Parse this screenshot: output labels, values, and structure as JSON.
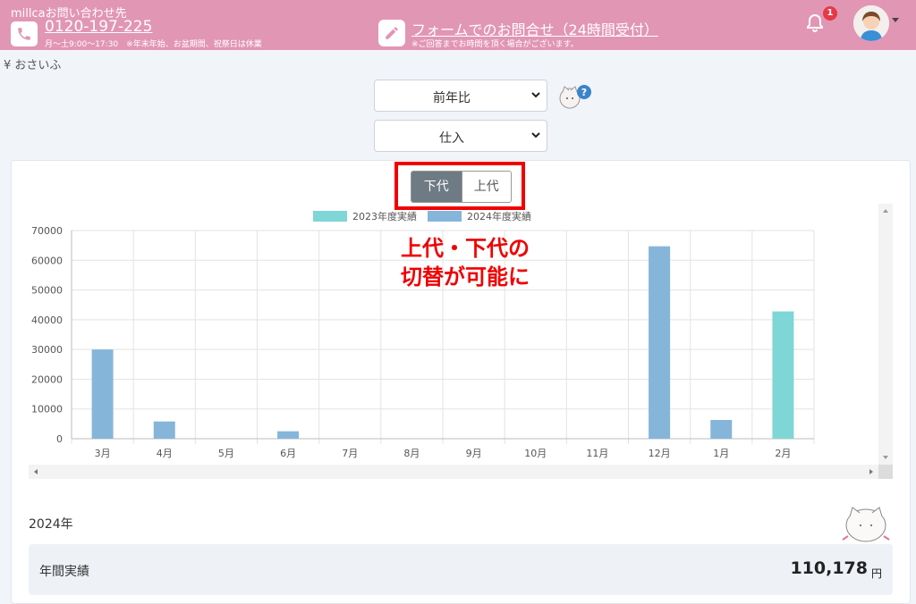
{
  "header": {
    "brand": "millcaお問い合わせ先",
    "phone": "0120-197-225",
    "hours": "月～土9:00～17:30　※年末年始、お盆期間、祝祭日は休業",
    "form_link": "フォームでのお問合せ（24時間受付）",
    "form_note": "※ご回答までお時間を頂く場合がございます。",
    "notification_count": "1"
  },
  "breadcrumb": "¥ おさいふ",
  "filters": {
    "comparison_select": "前年比",
    "type_select": "仕入"
  },
  "toggle": {
    "left_label": "下代",
    "right_label": "上代",
    "active": "left"
  },
  "annotation": {
    "line1": "上代・下代の",
    "line2": "切替が可能に",
    "color": "#f00000"
  },
  "chart_data": {
    "type": "bar",
    "categories": [
      "3月",
      "4月",
      "5月",
      "6月",
      "7月",
      "8月",
      "9月",
      "10月",
      "11月",
      "12月",
      "1月",
      "2月"
    ],
    "series": [
      {
        "name": "2023年度実績",
        "color": "#7fd6d6",
        "values": [
          0,
          0,
          0,
          0,
          0,
          0,
          0,
          0,
          0,
          0,
          0,
          42800
        ]
      },
      {
        "name": "2024年度実績",
        "color": "#86b5da",
        "values": [
          30000,
          5800,
          0,
          2500,
          0,
          0,
          0,
          0,
          0,
          64700,
          6300,
          0
        ]
      }
    ],
    "y_ticks": [
      "0",
      "10000",
      "20000",
      "30000",
      "40000",
      "50000",
      "60000",
      "70000"
    ],
    "ylim": [
      0,
      70000
    ],
    "grid": true,
    "legend_position": "top"
  },
  "summary": {
    "year": "2024年",
    "label": "年間実績",
    "value": "110,178",
    "unit": "円"
  }
}
